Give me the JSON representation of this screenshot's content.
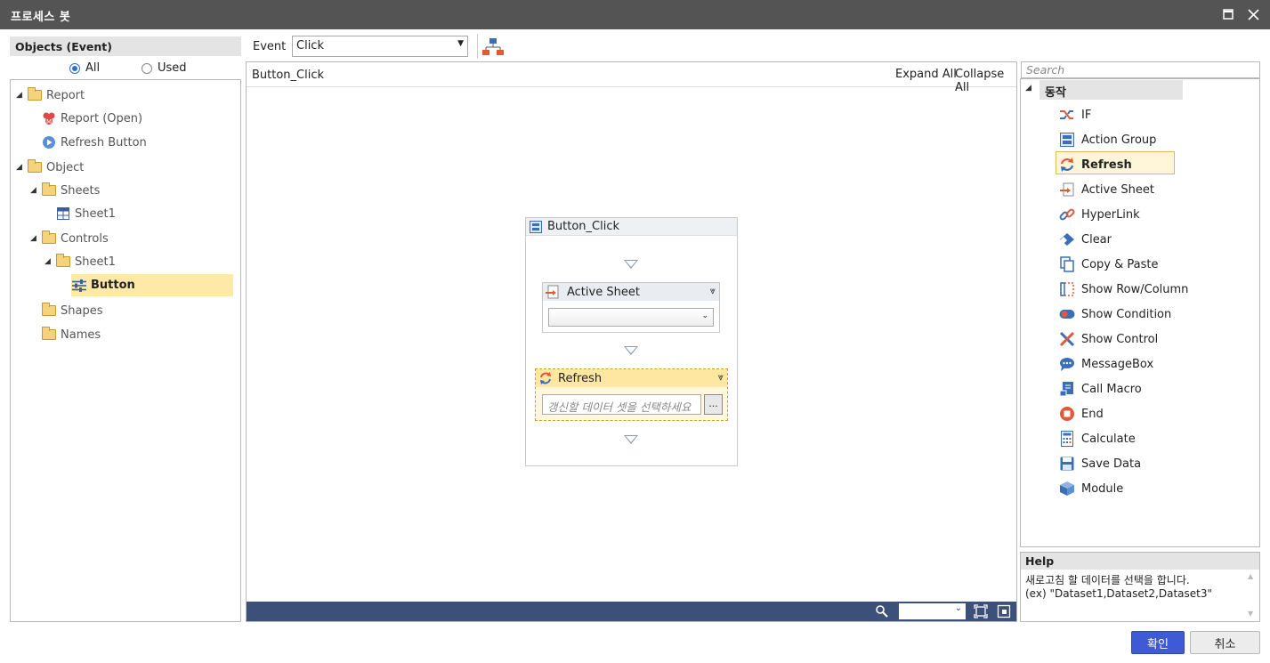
{
  "window": {
    "title": "프로세스 봇"
  },
  "left_panel": {
    "header": "Objects (Event)",
    "radio_all": "All",
    "radio_used": "Used",
    "tree": {
      "report": "Report",
      "report_open": "Report (Open)",
      "refresh_button": "Refresh Button",
      "object": "Object",
      "sheets": "Sheets",
      "sheet1": "Sheet1",
      "controls": "Controls",
      "controls_sheet1": "Sheet1",
      "button": "Button",
      "shapes": "Shapes",
      "names": "Names"
    }
  },
  "toolbar": {
    "event_label": "Event",
    "event_value": "Click"
  },
  "canvas": {
    "header_title": "Button_Click",
    "expand_all": "Expand All",
    "collapse_all": "Collapse All",
    "flow_title": "Button_Click",
    "active_sheet_title": "Active Sheet",
    "refresh_title": "Refresh",
    "refresh_placeholder": "갱신할 데이터 셋을 선택하세요",
    "browse_label": "..."
  },
  "right_panel": {
    "search_placeholder": "Search",
    "category": "동작",
    "actions": [
      "IF",
      "Action Group",
      "Refresh",
      "Active Sheet",
      "HyperLink",
      "Clear",
      "Copy & Paste",
      "Show Row/Column",
      "Show Condition",
      "Show Control",
      "MessageBox",
      "Call Macro",
      "End",
      "Calculate",
      "Save Data",
      "Module"
    ],
    "selected_action": "Refresh",
    "help_header": "Help",
    "help_line1": "새로고침 할 데이터를 선택을 합니다.",
    "help_line2": "(ex) \"Dataset1,Dataset2,Dataset3\""
  },
  "footer": {
    "ok_label": "확인",
    "cancel_label": "취소"
  },
  "colors": {
    "accent": "#2f6fd0",
    "selection": "#ffe9a8",
    "ok_button": "#3e5ad6",
    "statusbar": "#3d5079"
  }
}
